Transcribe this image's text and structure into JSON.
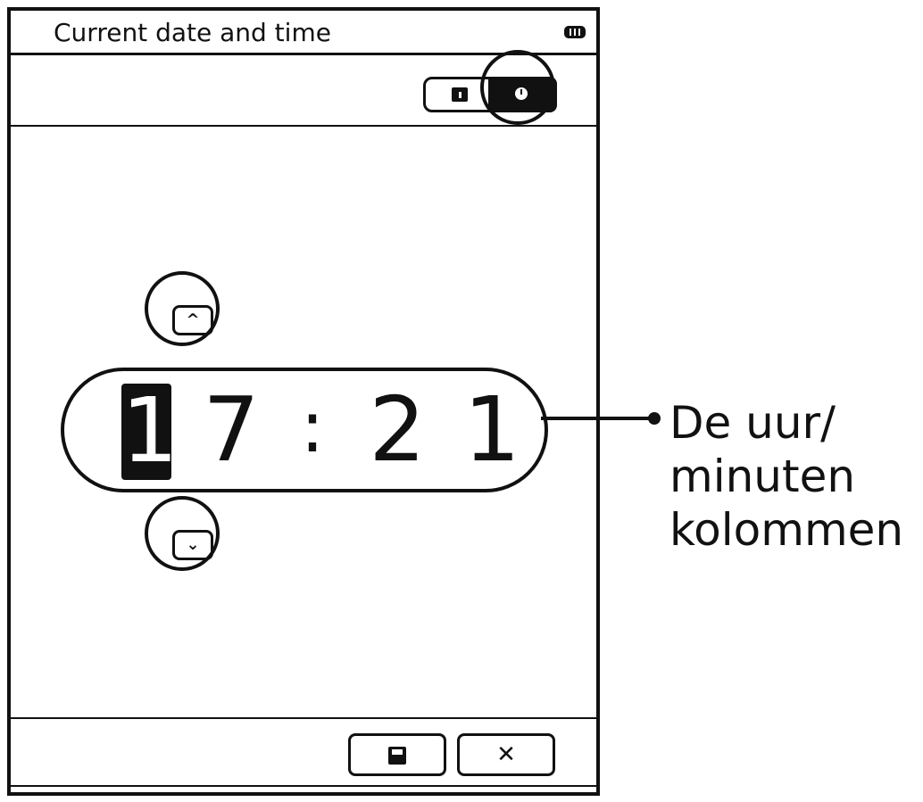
{
  "window": {
    "title": "Current date and time"
  },
  "toolbar": {
    "mode_calendar_icon": "calendar-icon",
    "mode_clock_icon": "clock-icon",
    "active_mode": "clock"
  },
  "time_picker": {
    "hour_tens": "1",
    "hour_units": "7",
    "separator": ":",
    "minute_tens": "2",
    "minute_units": "1",
    "selected_digit": "hour_tens",
    "up_symbol": "^",
    "down_symbol": "⌄"
  },
  "callout": {
    "lines": [
      "De uur/",
      "minuten",
      "kolommen"
    ]
  },
  "footer": {
    "save_icon": "save-icon",
    "close_symbol": "✕"
  },
  "colors": {
    "ink": "#111111",
    "background": "#ffffff"
  }
}
